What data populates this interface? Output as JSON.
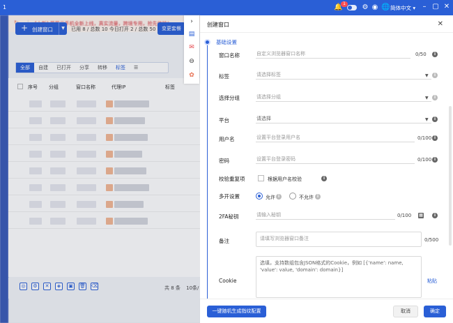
{
  "topbar": {
    "version": "1",
    "badge_count": "1",
    "language": "简体中文",
    "lang_arrow": "▾"
  },
  "colors": {
    "primary": "#2a5fd6",
    "danger": "#d9363e",
    "accent_orange": "#f4b894"
  },
  "notice": {
    "text": "[上新] 革草云手机全新上线，真实流量，跨境专用，抢先体验！"
  },
  "toolbar": {
    "create_label": "创建窗口",
    "stats": "已用 8 / 总数 10   今日打开 2 / 总数 50",
    "change_plan": "变更套餐"
  },
  "filter_tabs": [
    {
      "label": "全部"
    },
    {
      "label": "自建"
    },
    {
      "label": "已打开"
    },
    {
      "label": "分享"
    },
    {
      "label": "转移"
    },
    {
      "label": "标签"
    }
  ],
  "table": {
    "headers": {
      "seq": "序号",
      "group": "分组",
      "window_name": "窗口名称",
      "proxy_ip": "代理IP",
      "tag": "标签"
    }
  },
  "pager": {
    "text": "共 8 条",
    "page_size": "10条/"
  },
  "dialog": {
    "title": "创建窗口",
    "section": "基础设置",
    "fields": {
      "window_name": {
        "label": "窗口名称",
        "placeholder": "自定义浏览器窗口名称",
        "count": "0/50"
      },
      "tags": {
        "label": "标签",
        "placeholder": "请选择标签"
      },
      "group": {
        "label": "选择分组",
        "placeholder": "请选择分组"
      },
      "platform": {
        "label": "平台",
        "placeholder": "请选择"
      },
      "username": {
        "label": "用户名",
        "placeholder": "设置平台登录用户名",
        "count": "0/100"
      },
      "password": {
        "label": "密码",
        "placeholder": "设置平台登录密码",
        "count": "0/100"
      },
      "dup_check": {
        "label": "校验重复项",
        "option": "根据用户名校验"
      },
      "multi_open": {
        "label": "多开设置",
        "allow": "允许",
        "deny": "不允许"
      },
      "twofa": {
        "label": "2FA秘钥",
        "placeholder": "请输入秘钥",
        "count": "0/100"
      },
      "remark": {
        "label": "备注",
        "placeholder": "请填写浏览器窗口备注",
        "count": "0/500"
      },
      "cookie": {
        "label": "Cookie",
        "placeholder": "选填，支持数组包含JSON格式的Cookie，例如 [{'name': name, 'value': value, 'domain': domain}]",
        "paste": "粘贴"
      }
    },
    "footer": {
      "generate": "一键随机生成指纹配置",
      "cancel": "取消",
      "confirm": "确定"
    }
  }
}
